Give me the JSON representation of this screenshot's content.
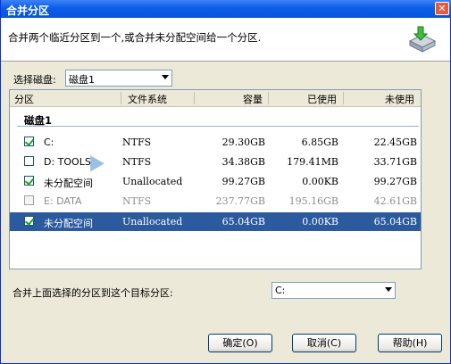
{
  "window": {
    "title": "合并分区",
    "close_glyph": "✕"
  },
  "header": {
    "description": "合并两个临近分区到一个,或合并未分配空间给一个分区."
  },
  "disk_select": {
    "label": "选择磁盘:",
    "value": "磁盘1"
  },
  "columns": [
    "分区",
    "文件系统",
    "容量",
    "已使用",
    "未使用"
  ],
  "group": {
    "label": "磁盘1"
  },
  "partitions": [
    {
      "name": "C:",
      "fs": "NTFS",
      "capacity": "29.30GB",
      "used": "6.85GB",
      "unused": "22.45GB",
      "checked": true,
      "selected": false,
      "disabled": false
    },
    {
      "name": "D:  TOOLS",
      "fs": "NTFS",
      "capacity": "34.38GB",
      "used": "179.41MB",
      "unused": "33.71GB",
      "checked": false,
      "selected": false,
      "disabled": false
    },
    {
      "name": "未分配空间",
      "fs": "Unallocated",
      "capacity": "99.27GB",
      "used": "0.00KB",
      "unused": "99.27GB",
      "checked": true,
      "selected": false,
      "disabled": false
    },
    {
      "name": "E:  DATA",
      "fs": "NTFS",
      "capacity": "237.77GB",
      "used": "195.16GB",
      "unused": "42.61GB",
      "checked": false,
      "selected": false,
      "disabled": true
    },
    {
      "name": "未分配空间",
      "fs": "Unallocated",
      "capacity": "65.04GB",
      "used": "0.00KB",
      "unused": "65.04GB",
      "checked": true,
      "selected": true,
      "disabled": false
    }
  ],
  "target": {
    "label": "合并上面选择的分区到这个目标分区:",
    "value": "C:"
  },
  "buttons": {
    "ok": "确定(O)",
    "cancel": "取消(C)",
    "help": "帮助(H)"
  },
  "colors": {
    "title_bar": "#0a5ee8",
    "selection": "#2c5a9e",
    "dialog_bg": "#ece9d8"
  }
}
